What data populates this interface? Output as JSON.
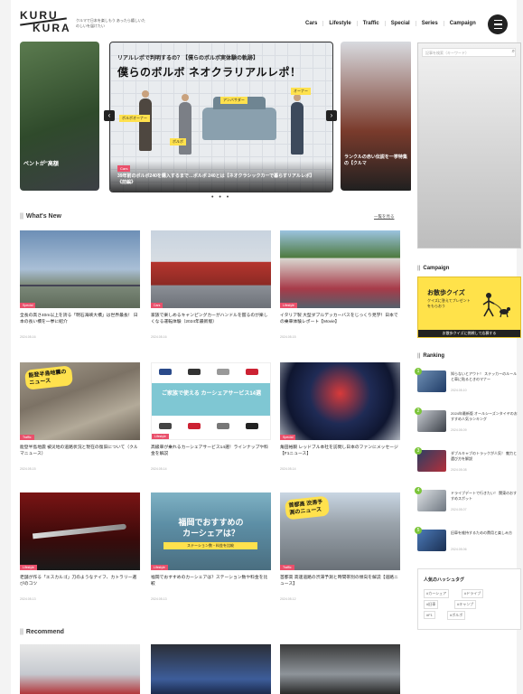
{
  "header": {
    "logo_top": "KURU",
    "logo_bottom": "KURA",
    "tagline": "クルマで日本を楽しもう あったら嬉しいたのしいを届けたい",
    "nav": [
      "Cars",
      "Lifestyle",
      "Traffic",
      "Special",
      "Series",
      "Campaign"
    ]
  },
  "hero": {
    "kicker": "リアルレポで判明するの？【僕らのボルボ実体験の軌跡】",
    "title": "僕らのボルボ ネオクラリアルレポ！",
    "caption": "39年前のボルボ240を購入するまで…ボルボ 240とは【ネオクラシックカーで暮らすリアルレポ】《前編》",
    "category": "Cars",
    "left_caption": "ベントが\"高額",
    "right_caption": "ランクルの赤い伝説を一挙特集の【クルマ",
    "labels": [
      "ボルボオーナー",
      "ボルボ",
      "アンバサダー",
      "オーナー"
    ]
  },
  "whats_new": {
    "title": "What's New",
    "see_all": "一覧を見る",
    "cards": [
      {
        "text": "全長の高さ40m以上を誇る「明石海峡大橋」は世界最長！ 日本の長い橋を一挙に紹介",
        "category": "Special",
        "date": "2024.05.16"
      },
      {
        "text": "家族で楽しめるキャンピングカーがハンドルを握るのが楽しくなる運転体験（2024年最新版）",
        "category": "Cars",
        "date": "2024.05.16"
      },
      {
        "text": "イタリア製 大型ダブルデッカーバスをじっくり見学！日本での乗車体験レポート【Movie】",
        "category": "Lifestyle",
        "date": "2024.05.15"
      },
      {
        "text": "能登半島地震 被災地の道路状況と現在の復旧について（クルマニュース）",
        "category": "Traffic",
        "date": "2024.05.15"
      },
      {
        "text": "高級車が乗れるカーシェアサービス14選！ラインナップや料金を解説",
        "category": "Lifestyle",
        "date": "2024.05.14"
      },
      {
        "text": "角田裕毅 レッドブル本社を訪問し日本のファンにメッセージ【F1ニュース】",
        "category": "Special",
        "date": "2024.05.14"
      },
      {
        "text": "老舗が作る「エスカルゴ」刀のようなナイフ、カトラリー選びのコツ",
        "category": "Lifestyle",
        "date": "2024.05.13"
      },
      {
        "text": "福岡でおすすめのカーシェアは？ステーション数や料金を比較",
        "category": "Lifestyle",
        "date": "2024.05.13"
      },
      {
        "text": "首都高 高速道路の渋滞予測と時間帯別の傾向を解説【道路ニュース】",
        "category": "Traffic",
        "date": "2024.05.12"
      }
    ],
    "stamp_news": "能登半島地震のニュース",
    "banner_carshare": "ご家族で使える カーシェアサービス14選",
    "banner_fukuoka_1": "福岡でおすすめの",
    "banner_fukuoka_2": "カーシェアは？",
    "banner_fukuoka_3": "ステーション数・料金を比較",
    "stamp_highway": "首都高 渋滞予測のニュース"
  },
  "recommend": {
    "title": "Recommend"
  },
  "sidebar": {
    "search_placeholder": "記事を検索（キーワード）",
    "campaign_title": "Campaign",
    "campaign_banner_title": "お散歩クイズ",
    "campaign_banner_text": "クイズに答えてプレゼントをもらおう",
    "campaign_banner_footer": "お散歩クイズに挑戦して応募する",
    "ranking_title": "Ranking",
    "ranking": [
      {
        "text": "知らないとアウト！ ステッカーのルールと車に貼るときのマナー",
        "date": "2024.05.10"
      },
      {
        "text": "2024年最新版 オールシーズンタイヤのおすすめ人気ランキング",
        "date": "2024.05.09"
      },
      {
        "text": "ダブルキャブのトラックが人気！ 魅力と選び方を解説",
        "date": "2024.05.08"
      },
      {
        "text": "ドライブデートで行きたい！ 関東のおすすめスポット",
        "date": "2024.05.07"
      },
      {
        "text": "旧車を維持するための費用と楽しみ方",
        "date": "2024.05.06"
      }
    ],
    "keyword_title": "人気のハッシュタグ",
    "keywords": [
      "#カーシェア",
      "#ドライブ",
      "#旧車",
      "#キャンプ",
      "#F1",
      "#ボルボ"
    ]
  }
}
